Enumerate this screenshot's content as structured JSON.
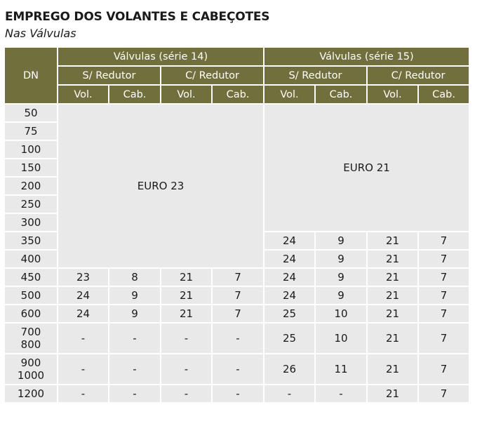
{
  "title": "EMPREGO DOS VOLANTES E CABEÇOTES",
  "subtitle": "Nas Válvulas",
  "header": {
    "dn": "DN",
    "group14": "Válvulas (série 14)",
    "group15": "Válvulas (série 15)",
    "s_redutor": "S/ Redutor",
    "c_redutor": "C/ Redutor",
    "vol": "Vol.",
    "cab": "Cab."
  },
  "euro23": "EURO 23",
  "euro21": "EURO 21",
  "rows": [
    {
      "dn": "50"
    },
    {
      "dn": "75"
    },
    {
      "dn": "100"
    },
    {
      "dn": "150"
    },
    {
      "dn": "200"
    },
    {
      "dn": "250"
    },
    {
      "dn": "300"
    },
    {
      "dn": "350",
      "c15": [
        "24",
        "9",
        "21",
        "7"
      ]
    },
    {
      "dn": "400",
      "c15": [
        "24",
        "9",
        "21",
        "7"
      ]
    },
    {
      "dn": "450",
      "c14": [
        "23",
        "8",
        "21",
        "7"
      ],
      "c15": [
        "24",
        "9",
        "21",
        "7"
      ]
    },
    {
      "dn": "500",
      "c14": [
        "24",
        "9",
        "21",
        "7"
      ],
      "c15": [
        "24",
        "9",
        "21",
        "7"
      ]
    },
    {
      "dn": "600",
      "c14": [
        "24",
        "9",
        "21",
        "7"
      ],
      "c15": [
        "25",
        "10",
        "21",
        "7"
      ]
    },
    {
      "dn": "700",
      "dn2": "800",
      "c14": [
        "-",
        "-",
        "-",
        "-"
      ],
      "c15": [
        "25",
        "10",
        "21",
        "7"
      ]
    },
    {
      "dn": "900",
      "dn2": "1000",
      "c14": [
        "-",
        "-",
        "-",
        "-"
      ],
      "c15": [
        "26",
        "11",
        "21",
        "7"
      ]
    },
    {
      "dn": "1200",
      "c14": [
        "-",
        "-",
        "-",
        "-"
      ],
      "c15": [
        "-",
        "-",
        "21",
        "7"
      ]
    }
  ]
}
